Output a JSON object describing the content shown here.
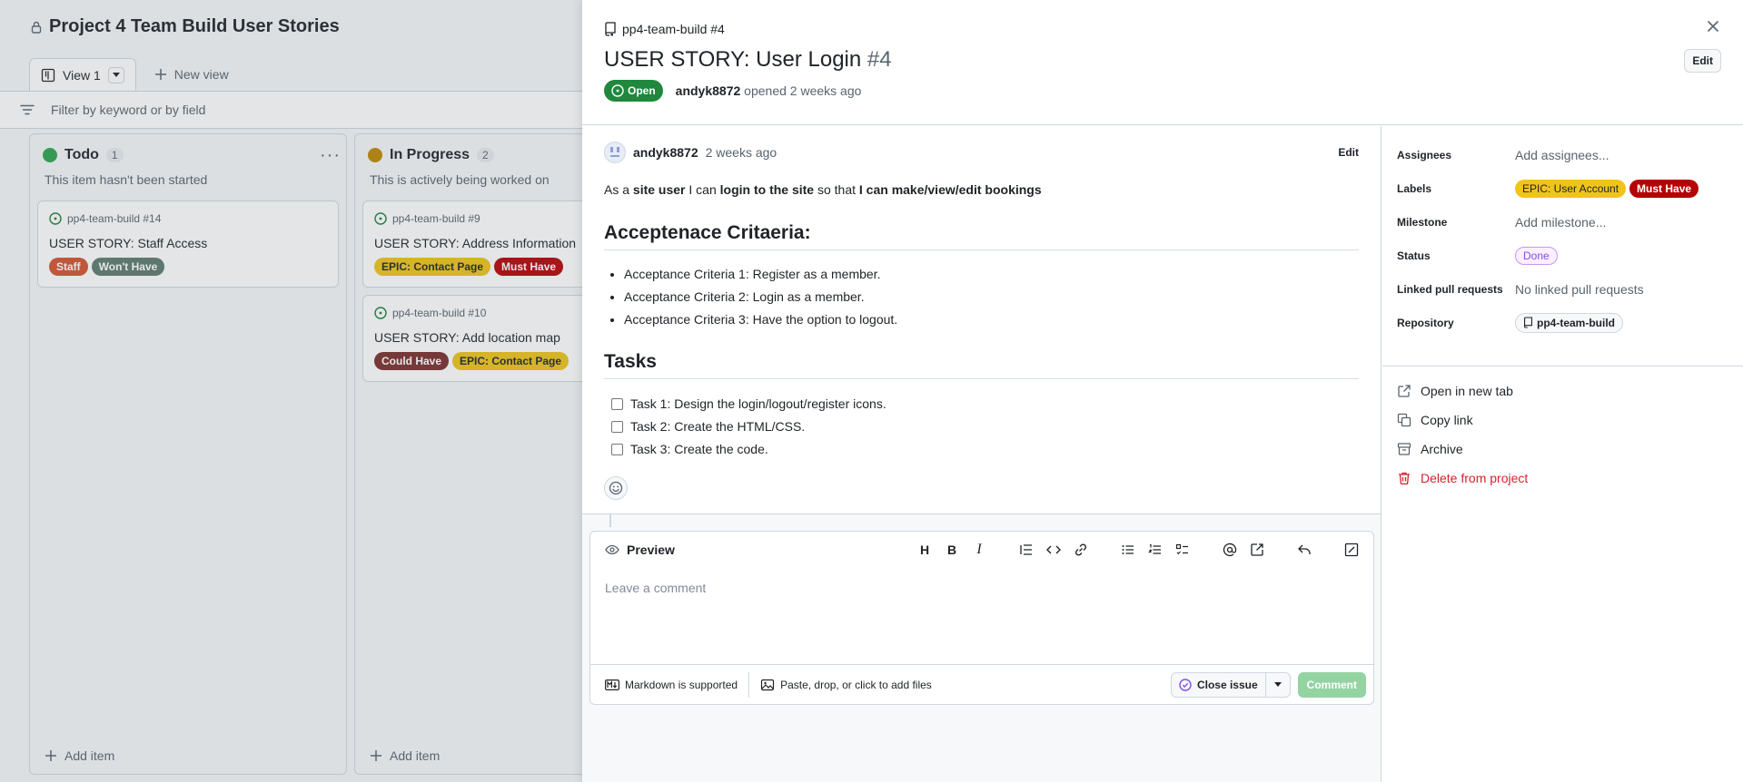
{
  "board": {
    "project_title": "Project 4 Team Build User Stories",
    "view_tab": "View 1",
    "new_view": "New view",
    "filter_placeholder": "Filter by keyword or by field",
    "columns": [
      {
        "title": "Todo",
        "count": "1",
        "description": "This item hasn't been started",
        "dot_color": "#2da44e",
        "add_item": "Add item",
        "cards": [
          {
            "ref": "pp4-team-build #14",
            "title": "USER STORY: Staff Access",
            "labels": [
              {
                "text": "Staff",
                "bg": "#d4522f",
                "fg": "#ffffff"
              },
              {
                "text": "Won't Have",
                "bg": "#5d7b6f",
                "fg": "#ffffff"
              }
            ]
          }
        ]
      },
      {
        "title": "In Progress",
        "count": "2",
        "description": "This is actively being worked on",
        "dot_color": "#bf8700",
        "add_item": "Add item",
        "cards": [
          {
            "ref": "pp4-team-build #9",
            "title": "USER STORY: Address Information",
            "labels": [
              {
                "text": "EPIC: Contact Page",
                "bg": "#f0c419",
                "fg": "#1f2328"
              },
              {
                "text": "Must Have",
                "bg": "#b60205",
                "fg": "#ffffff"
              }
            ]
          },
          {
            "ref": "pp4-team-build #10",
            "title": "USER STORY: Add location map",
            "labels": [
              {
                "text": "Could Have",
                "bg": "#7a2e2e",
                "fg": "#ffffff"
              },
              {
                "text": "EPIC: Contact Page",
                "bg": "#f0c419",
                "fg": "#1f2328"
              }
            ]
          }
        ]
      }
    ]
  },
  "issue": {
    "repo_ref": "pp4-team-build #4",
    "title": "USER STORY: User Login",
    "number": "#4",
    "edit_title": "Edit",
    "state": "Open",
    "author": "andyk8872",
    "opened_text": "opened 2 weeks ago",
    "comment": {
      "author": "andyk8872",
      "time": "2 weeks ago",
      "edit": "Edit",
      "body_parts": [
        {
          "t": "As a ",
          "b": false
        },
        {
          "t": "site user",
          "b": true
        },
        {
          "t": " I can ",
          "b": false
        },
        {
          "t": "login to the site",
          "b": true
        },
        {
          "t": " so that ",
          "b": false
        },
        {
          "t": "I can make/view/edit bookings",
          "b": true
        }
      ],
      "heading1": "Acceptenace Critaeria:",
      "criteria": [
        "Acceptance Criteria 1: Register as a member.",
        "Acceptance Criteria 2: Login as a member.",
        "Acceptance Criteria 3: Have the option to logout."
      ],
      "heading2": "Tasks",
      "tasks": [
        "Task 1: Design the login/logout/register icons.",
        "Task 2: Create the HTML/CSS.",
        "Task 3: Create the code."
      ]
    },
    "composer": {
      "preview_tab": "Preview",
      "placeholder": "Leave a comment",
      "markdown_note": "Markdown is supported",
      "attach_note": "Paste, drop, or click to add files",
      "close_issue": "Close issue",
      "comment_button": "Comment"
    },
    "sidebar": {
      "assignees_label": "Assignees",
      "assignees_value": "Add assignees...",
      "labels_label": "Labels",
      "labels": [
        {
          "text": "EPIC: User Account",
          "bg": "#f0c419",
          "fg": "#1f2328"
        },
        {
          "text": "Must Have",
          "bg": "#b60205",
          "fg": "#ffffff"
        }
      ],
      "milestone_label": "Milestone",
      "milestone_value": "Add milestone...",
      "status_label": "Status",
      "status_value": "Done",
      "linked_label": "Linked pull requests",
      "linked_value": "No linked pull requests",
      "repository_label": "Repository",
      "repository_value": "pp4-team-build",
      "actions": {
        "open_new_tab": "Open in new tab",
        "copy_link": "Copy link",
        "archive": "Archive",
        "delete": "Delete from project"
      }
    }
  }
}
